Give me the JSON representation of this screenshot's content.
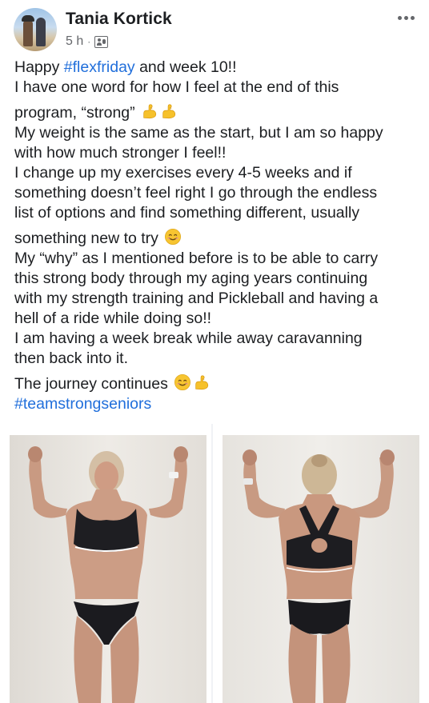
{
  "post": {
    "author": "Tania Kortick",
    "time": "5 h",
    "separator": "·",
    "audience_icon": "friends-icon",
    "more_icon": "more-options-icon",
    "text": {
      "l1_a": "Happy ",
      "l1_tag": "#flexfriday",
      "l1_b": " and week 10!!",
      "l2": "I have one word for how I feel at the end of this",
      "l3": "program, “strong”",
      "l4": "My weight is the same as the start, but I am so happy",
      "l5": "with how much stronger I feel!!",
      "l6": "I change up my exercises every 4-5 weeks and if",
      "l7": "something doesn’t feel right I go through the endless",
      "l8": "list of options and find something different, usually",
      "l9": "something new to try",
      "l10": "My “why” as I mentioned before is to be able to carry",
      "l11": "this strong body through my aging years continuing",
      "l12": "with my strength training and Pickleball and having a",
      "l13": "hell of a ride while doing so!!",
      "l14": "I am having a week break while away caravanning",
      "l15": "then back into it.",
      "l16": "The journey continues",
      "l17_tag": "#teamstrongseniors"
    },
    "emojis": {
      "flexed_biceps": "flexed-biceps-emoji",
      "smiling_face": "smiling-face-emoji"
    },
    "photos": [
      {
        "name": "front-view-photo"
      },
      {
        "name": "back-view-photo"
      }
    ]
  },
  "colors": {
    "hashtag": "#216fdb",
    "meta": "#65676b",
    "text": "#1c1e21",
    "emoji_yellow": "#f6c12b"
  }
}
